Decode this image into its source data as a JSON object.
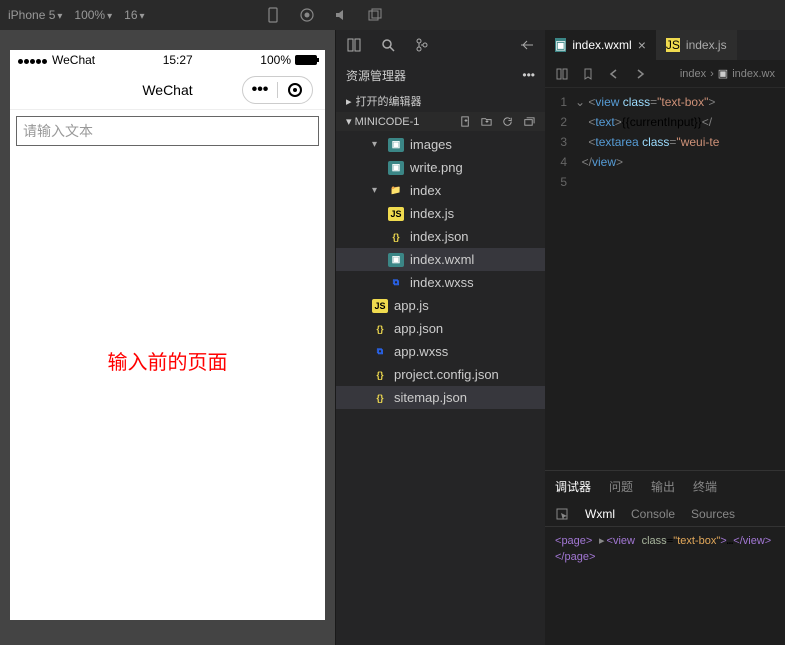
{
  "topbar": {
    "device": "iPhone 5",
    "zoom": "100%",
    "frame": "16"
  },
  "simulator": {
    "carrier": "WeChat",
    "time": "15:27",
    "battery": "100%",
    "navTitle": "WeChat",
    "placeholder": "请输入文本",
    "caption": "输入前的页面"
  },
  "explorer": {
    "title": "资源管理器",
    "openEditors": "打开的编辑器",
    "project": "MINICODE-1",
    "tree": {
      "images": "images",
      "write": "write.png",
      "index": "index",
      "indexjs": "index.js",
      "indexjson": "index.json",
      "indexwxml": "index.wxml",
      "indexwxss": "index.wxss",
      "appjs": "app.js",
      "appjson": "app.json",
      "appwxss": "app.wxss",
      "projconf": "project.config.json",
      "sitemap": "sitemap.json"
    }
  },
  "tabs": {
    "wxml": "index.wxml",
    "js": "index.js"
  },
  "breadcrumb": {
    "seg1": "index",
    "seg2": "index.wx"
  },
  "code": {
    "l1": {
      "tag": "view",
      "attr": "class",
      "val": "text-box"
    },
    "l2": {
      "tag": "text",
      "body": "{{currentInput}}"
    },
    "l3": {
      "tag": "textarea",
      "attr": "class",
      "val": "weui-te"
    },
    "l4": {
      "tag": "view"
    }
  },
  "panel": {
    "tabs": {
      "debug": "调试器",
      "problems": "问题",
      "output": "输出",
      "terminal": "终端"
    },
    "sub": {
      "wxml": "Wxml",
      "console": "Console",
      "sources": "Sources"
    },
    "dom": {
      "page": "page",
      "view": "view",
      "cls": "text-box"
    }
  }
}
